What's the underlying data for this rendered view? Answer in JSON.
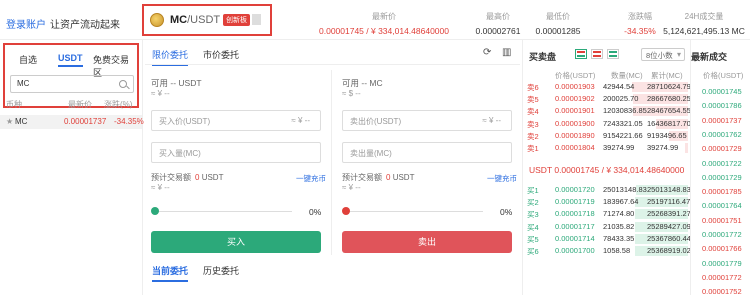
{
  "header": {
    "login_link": "登录账户",
    "login_text": "让资产流动起来",
    "pair_base": "MC",
    "pair_quote": "/USDT",
    "pair_badge": "创新板",
    "stats": [
      {
        "label": "最新价",
        "value": "0.00001745 / ¥ 334,014.48640000",
        "color": "#e0403a"
      },
      {
        "label": "最高价",
        "value": "0.00002761",
        "color": "#333333"
      },
      {
        "label": "最低价",
        "value": "0.00001285",
        "color": "#333333"
      },
      {
        "label": "涨跌幅",
        "value": "-34.35%",
        "color": "#e0403a"
      },
      {
        "label": "24H成交量",
        "value": "5,124,621,495.13 MC",
        "color": "#333333"
      }
    ]
  },
  "sidebar": {
    "tabs": [
      "自选",
      "USDT",
      "免费交易区"
    ],
    "search_value": "MC",
    "columns": [
      "币种",
      "最新价",
      "涨跌(%)"
    ],
    "rows": [
      {
        "name": "MC",
        "price": "0.00001737",
        "change": "-34.35%"
      }
    ]
  },
  "trade": {
    "tabs": [
      "限价委托",
      "市价委托"
    ],
    "buy": {
      "available": "可用 -- USDT",
      "approx": "≈ ¥ --",
      "price_placeholder": "买入价(USDT)",
      "price_suffix": "≈ ¥ --",
      "qty_placeholder": "买入量(MC)",
      "est_label": "预计交易额",
      "est_value": "0",
      "est_unit": "USDT",
      "est_approx": "≈ ¥ --",
      "onekey": "一键充币",
      "percent": "0%",
      "button": "买入"
    },
    "sell": {
      "available": "可用 -- MC",
      "approx": "≈ $ --",
      "price_placeholder": "卖出价(USDT)",
      "price_suffix": "≈ ¥ --",
      "qty_placeholder": "卖出量(MC)",
      "est_label": "预计交易额",
      "est_value": "0",
      "est_unit": "USDT",
      "est_approx": "≈ ¥ --",
      "onekey": "一键充币",
      "percent": "0%",
      "button": "卖出"
    },
    "order_tabs": [
      "当前委托",
      "历史委托"
    ]
  },
  "orderbook": {
    "title": "买卖盘",
    "decimals": "8位小数",
    "columns": [
      "价格(USDT)",
      "数量(MC)",
      "累计(MC)"
    ],
    "asks": [
      {
        "label": "卖6",
        "price": "0.00001903",
        "qty": "42944.54",
        "total": "28710624.79",
        "depth": 0.96
      },
      {
        "label": "卖5",
        "price": "0.00001902",
        "qty": "200025.70",
        "total": "28667680.25",
        "depth": 0.95
      },
      {
        "label": "卖4",
        "price": "0.00001901",
        "qty": "12030836.85",
        "total": "28467654.55",
        "depth": 0.94
      },
      {
        "label": "卖3",
        "price": "0.00001900",
        "qty": "7243321.05",
        "total": "16436817.70",
        "depth": 0.56
      },
      {
        "label": "卖2",
        "price": "0.00001890",
        "qty": "9154221.66",
        "total": "9193496.65",
        "depth": 0.33
      },
      {
        "label": "卖1",
        "price": "0.00001804",
        "qty": "39274.99",
        "total": "39274.99",
        "depth": 0.05
      }
    ],
    "last_price": "USDT 0.00001745 / ¥ 334,014.48640000",
    "bids": [
      {
        "label": "买1",
        "price": "0.00001720",
        "qty": "25013148.83",
        "total": "25013148.83",
        "depth": 0.9
      },
      {
        "label": "买2",
        "price": "0.00001719",
        "qty": "183967.64",
        "total": "25197116.47",
        "depth": 0.91
      },
      {
        "label": "买3",
        "price": "0.00001718",
        "qty": "71274.80",
        "total": "25268391.27",
        "depth": 0.91
      },
      {
        "label": "买4",
        "price": "0.00001717",
        "qty": "21035.82",
        "total": "25289427.09",
        "depth": 0.92
      },
      {
        "label": "买5",
        "price": "0.00001714",
        "qty": "78433.35",
        "total": "25367860.44",
        "depth": 0.92
      },
      {
        "label": "买6",
        "price": "0.00001700",
        "qty": "1058.58",
        "total": "25368919.02",
        "depth": 0.92
      }
    ]
  },
  "latest": {
    "title": "最新成交",
    "column": "价格(USDT)",
    "prices": [
      {
        "v": "0.00001745",
        "c": "green"
      },
      {
        "v": "0.00001786",
        "c": "green"
      },
      {
        "v": "0.00001737",
        "c": "red"
      },
      {
        "v": "0.00001762",
        "c": "green"
      },
      {
        "v": "0.00001729",
        "c": "red"
      },
      {
        "v": "0.00001722",
        "c": "green"
      },
      {
        "v": "0.00001729",
        "c": "green"
      },
      {
        "v": "0.00001785",
        "c": "red"
      },
      {
        "v": "0.00001764",
        "c": "green"
      },
      {
        "v": "0.00001751",
        "c": "red"
      },
      {
        "v": "0.00001772",
        "c": "green"
      },
      {
        "v": "0.00001766",
        "c": "red"
      },
      {
        "v": "0.00001779",
        "c": "green"
      },
      {
        "v": "0.00001772",
        "c": "red"
      },
      {
        "v": "0.00001752",
        "c": "red"
      }
    ]
  }
}
